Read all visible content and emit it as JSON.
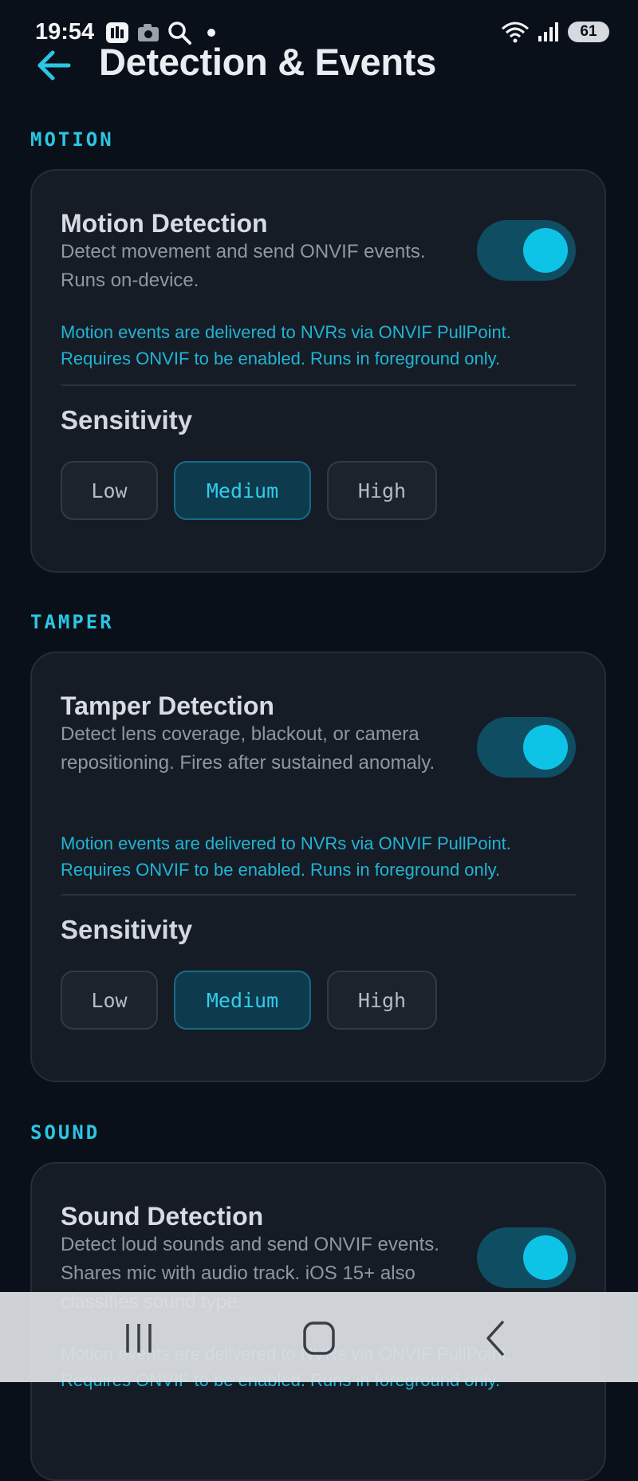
{
  "status_bar": {
    "time": "19:54",
    "battery": "61",
    "icons_left": [
      "gallery-icon",
      "camera-icon",
      "search-icon",
      "dot-icon"
    ],
    "icons_right": [
      "wifi-icon",
      "signal-icon",
      "battery-icon"
    ]
  },
  "header": {
    "title": "Detection & Events",
    "back_icon": "arrow-left-icon"
  },
  "sections": {
    "motion": {
      "label": "MOTION",
      "title": "Motion Detection",
      "description": "Detect movement and send ONVIF events. Runs on-device.",
      "note": "Motion events are delivered to NVRs via ONVIF PullPoint. Requires ONVIF to be enabled. Runs in foreground only.",
      "enabled": true,
      "sensitivity_title": "Sensitivity",
      "options": [
        "Low",
        "Medium",
        "High"
      ],
      "selected": "Medium"
    },
    "tamper": {
      "label": "TAMPER",
      "title": "Tamper Detection",
      "description": "Detect lens coverage, blackout, or camera repositioning. Fires after sustained anomaly.",
      "note": "Motion events are delivered to NVRs via ONVIF PullPoint. Requires ONVIF to be enabled. Runs in foreground only.",
      "enabled": true,
      "sensitivity_title": "Sensitivity",
      "options": [
        "Low",
        "Medium",
        "High"
      ],
      "selected": "Medium"
    },
    "sound": {
      "label": "SOUND",
      "title": "Sound Detection",
      "description": "Detect loud sounds and send ONVIF events. Shares mic with audio track. iOS 15+ also classifies sound type.",
      "note": "Motion events are delivered to NVRs via ONVIF PullPoint. Requires ONVIF to be enabled. Runs in foreground only.",
      "enabled": true
    }
  },
  "nav_bar": {
    "buttons": [
      "recents-icon",
      "home-icon",
      "back-icon"
    ]
  },
  "colors": {
    "background": "#0a1019",
    "card": "#161c26",
    "accent": "#2cc6e4",
    "toggle_track": "#0f4d63",
    "toggle_knob": "#0dc4e6",
    "selected_segment": "#0e3a4e"
  }
}
